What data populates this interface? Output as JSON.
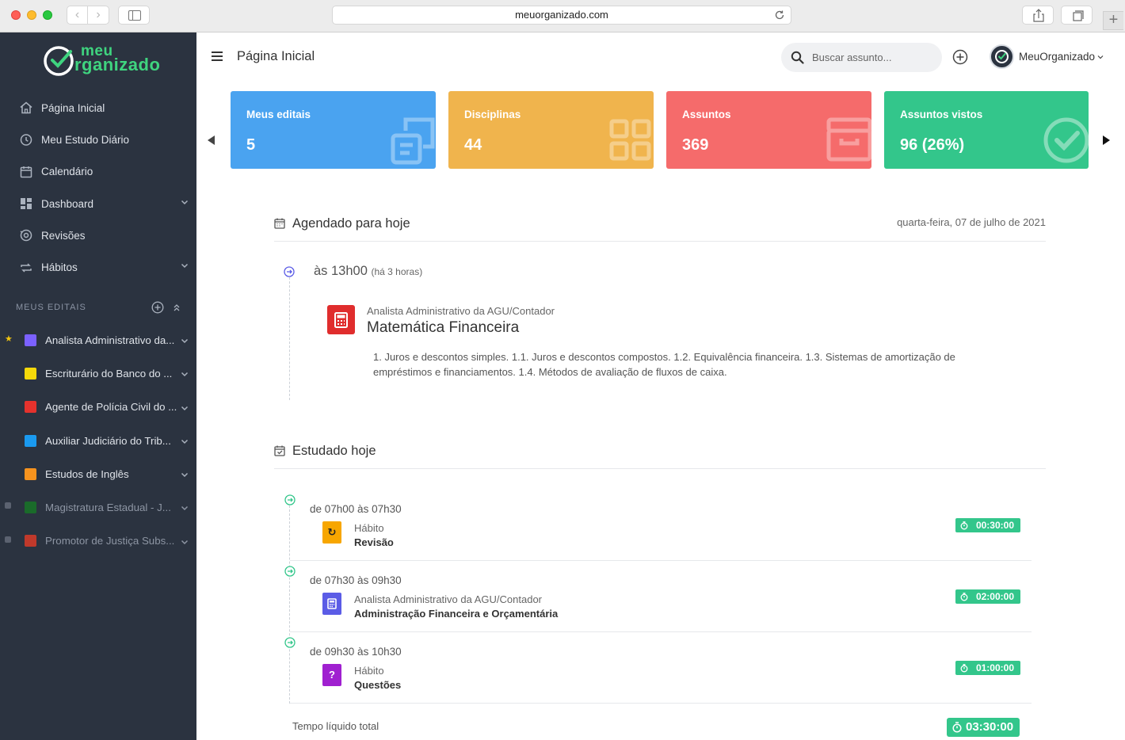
{
  "browser": {
    "url": "meuorganizado.com"
  },
  "sidebar": {
    "logo": {
      "top": "meu",
      "bottom": "rganizado"
    },
    "menu": [
      {
        "label": "Página Inicial",
        "icon": "home-icon"
      },
      {
        "label": "Meu Estudo Diário",
        "icon": "clock-icon"
      },
      {
        "label": "Calendário",
        "icon": "calendar-icon"
      },
      {
        "label": "Dashboard",
        "icon": "dashboard-icon"
      },
      {
        "label": "Revisões",
        "icon": "review-icon"
      },
      {
        "label": "Hábitos",
        "icon": "repeat-icon"
      }
    ],
    "section_title": "MEUS EDITAIS",
    "editais": [
      {
        "label": "Analista Administrativo da...",
        "color": "#7b61ff"
      },
      {
        "label": "Escriturário do Banco do ...",
        "color": "#f5d90a"
      },
      {
        "label": "Agente de Polícia Civil do ...",
        "color": "#e5322d"
      },
      {
        "label": "Auxiliar Judiciário do Trib...",
        "color": "#1a9af0"
      },
      {
        "label": "Estudos de Inglês",
        "color": "#f7931e"
      },
      {
        "label": "Magistratura Estadual - J...",
        "color": "#1a6b2a"
      },
      {
        "label": "Promotor de Justiça Subs...",
        "color": "#c0392b"
      }
    ]
  },
  "topbar": {
    "title": "Página Inicial",
    "search_placeholder": "Buscar assunto...",
    "user_name": "MeuOrganizado"
  },
  "cards": [
    {
      "title": "Meus editais",
      "value": "5",
      "color": "#4aa3f0",
      "icon": "edital-icon"
    },
    {
      "title": "Disciplinas",
      "value": "44",
      "color": "#f0b44d",
      "icon": "grid-icon"
    },
    {
      "title": "Assuntos",
      "value": "369",
      "color": "#f56b6b",
      "icon": "archive-icon"
    },
    {
      "title": "Assuntos vistos",
      "value": "96 (26%)",
      "color": "#33c68b",
      "icon": "check-circle-icon"
    }
  ],
  "agenda": {
    "title": "Agendado para hoje",
    "date": "quarta-feira, 07 de julho de 2021",
    "time": "às 13h00",
    "time_note": "(há 3 horas)",
    "subtitle": "Analista Administrativo da AGU/Contador",
    "discipline": "Matemática Financeira",
    "description": "1. Juros e descontos simples. 1.1. Juros e descontos compostos. 1.2. Equivalência financeira. 1.3. Sistemas de amortização de empréstimos e financiamentos. 1.4. Métodos de avaliação de fluxos de caixa."
  },
  "studied": {
    "title": "Estudado hoje",
    "entries": [
      {
        "time": "de 07h00 às 07h30",
        "subtitle": "Hábito",
        "name": "Revisão",
        "duration": "00:30:00",
        "icon_color": "#f7a600",
        "glyph": "↻"
      },
      {
        "time": "de 07h30 às 09h30",
        "subtitle": "Analista Administrativo da AGU/Contador",
        "name": "Administração Financeira e Orçamentária",
        "duration": "02:00:00",
        "icon_color": "#5b5ce6",
        "glyph": ""
      },
      {
        "time": "de 09h30 às 10h30",
        "subtitle": "Hábito",
        "name": "Questões",
        "duration": "01:00:00",
        "icon_color": "#a020d0",
        "glyph": "?"
      }
    ],
    "total_label": "Tempo líquido total",
    "total": "03:30:00"
  }
}
